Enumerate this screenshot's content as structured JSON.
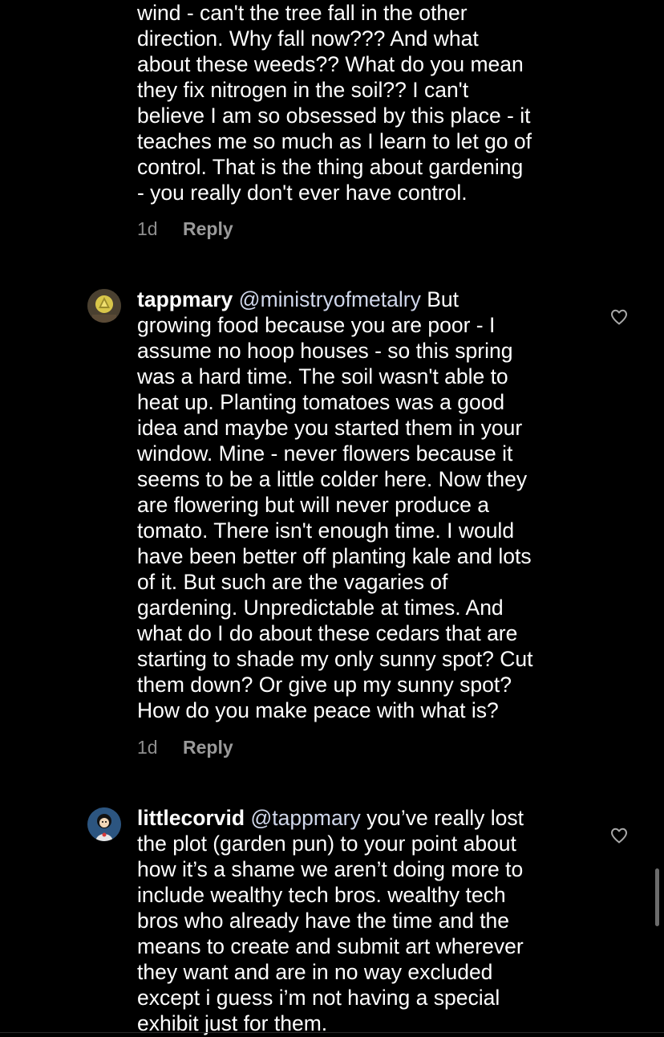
{
  "comments": [
    {
      "username": "",
      "mention": "",
      "first_line_rest": "",
      "lines": [
        "wind - can't the tree fall in the other",
        "direction. Why fall now??? And what",
        "about these weeds?? What do you mean",
        "they fix nitrogen in the soil?? I can't",
        "believe I am so obsessed by this place - it",
        "teaches me so much as I learn to let go of",
        "control. That is the thing about gardening",
        "- you really don't ever have control."
      ],
      "time": "1d",
      "reply_label": "Reply"
    },
    {
      "username": "tappmary",
      "mention": "@ministryofmetalry",
      "first_line_rest": " But",
      "lines": [
        "growing food because you are poor - I",
        "assume no hoop houses - so this spring",
        "was a hard time. The soil wasn't able to",
        "heat up. Planting tomatoes was a good",
        "idea and maybe you started them in your",
        "window. Mine - never flowers because it",
        "seems to be a little colder here. Now they",
        "are flowering but will never produce a",
        "tomato. There isn't enough time. I would",
        "have been better off planting kale and lots",
        "of it. But such are the vagaries of",
        "gardening. Unpredictable at times. And",
        "what do I do about these cedars that are",
        "starting to shade my only sunny spot? Cut",
        "them down? Or give up my sunny spot?",
        "How do you make peace with what is?"
      ],
      "time": "1d",
      "reply_label": "Reply",
      "like_icon": "heart-outline-icon"
    },
    {
      "username": "littlecorvid",
      "mention": "@tappmary",
      "first_line_rest": " you’ve really lost",
      "lines": [
        "the plot (garden pun) to your point about",
        "how it’s a shame we aren’t doing more to",
        "include wealthy tech bros. wealthy tech",
        "bros who already have the time and the",
        "means to create and submit art wherever",
        "they want and are in no way excluded",
        "except i guess i’m not having a special",
        "exhibit just for them."
      ],
      "like_icon": "heart-outline-icon"
    }
  ],
  "colors": {
    "background": "#000000",
    "text": "#ffffff",
    "mention": "#cfd6ea",
    "meta": "#8e8e8e"
  }
}
